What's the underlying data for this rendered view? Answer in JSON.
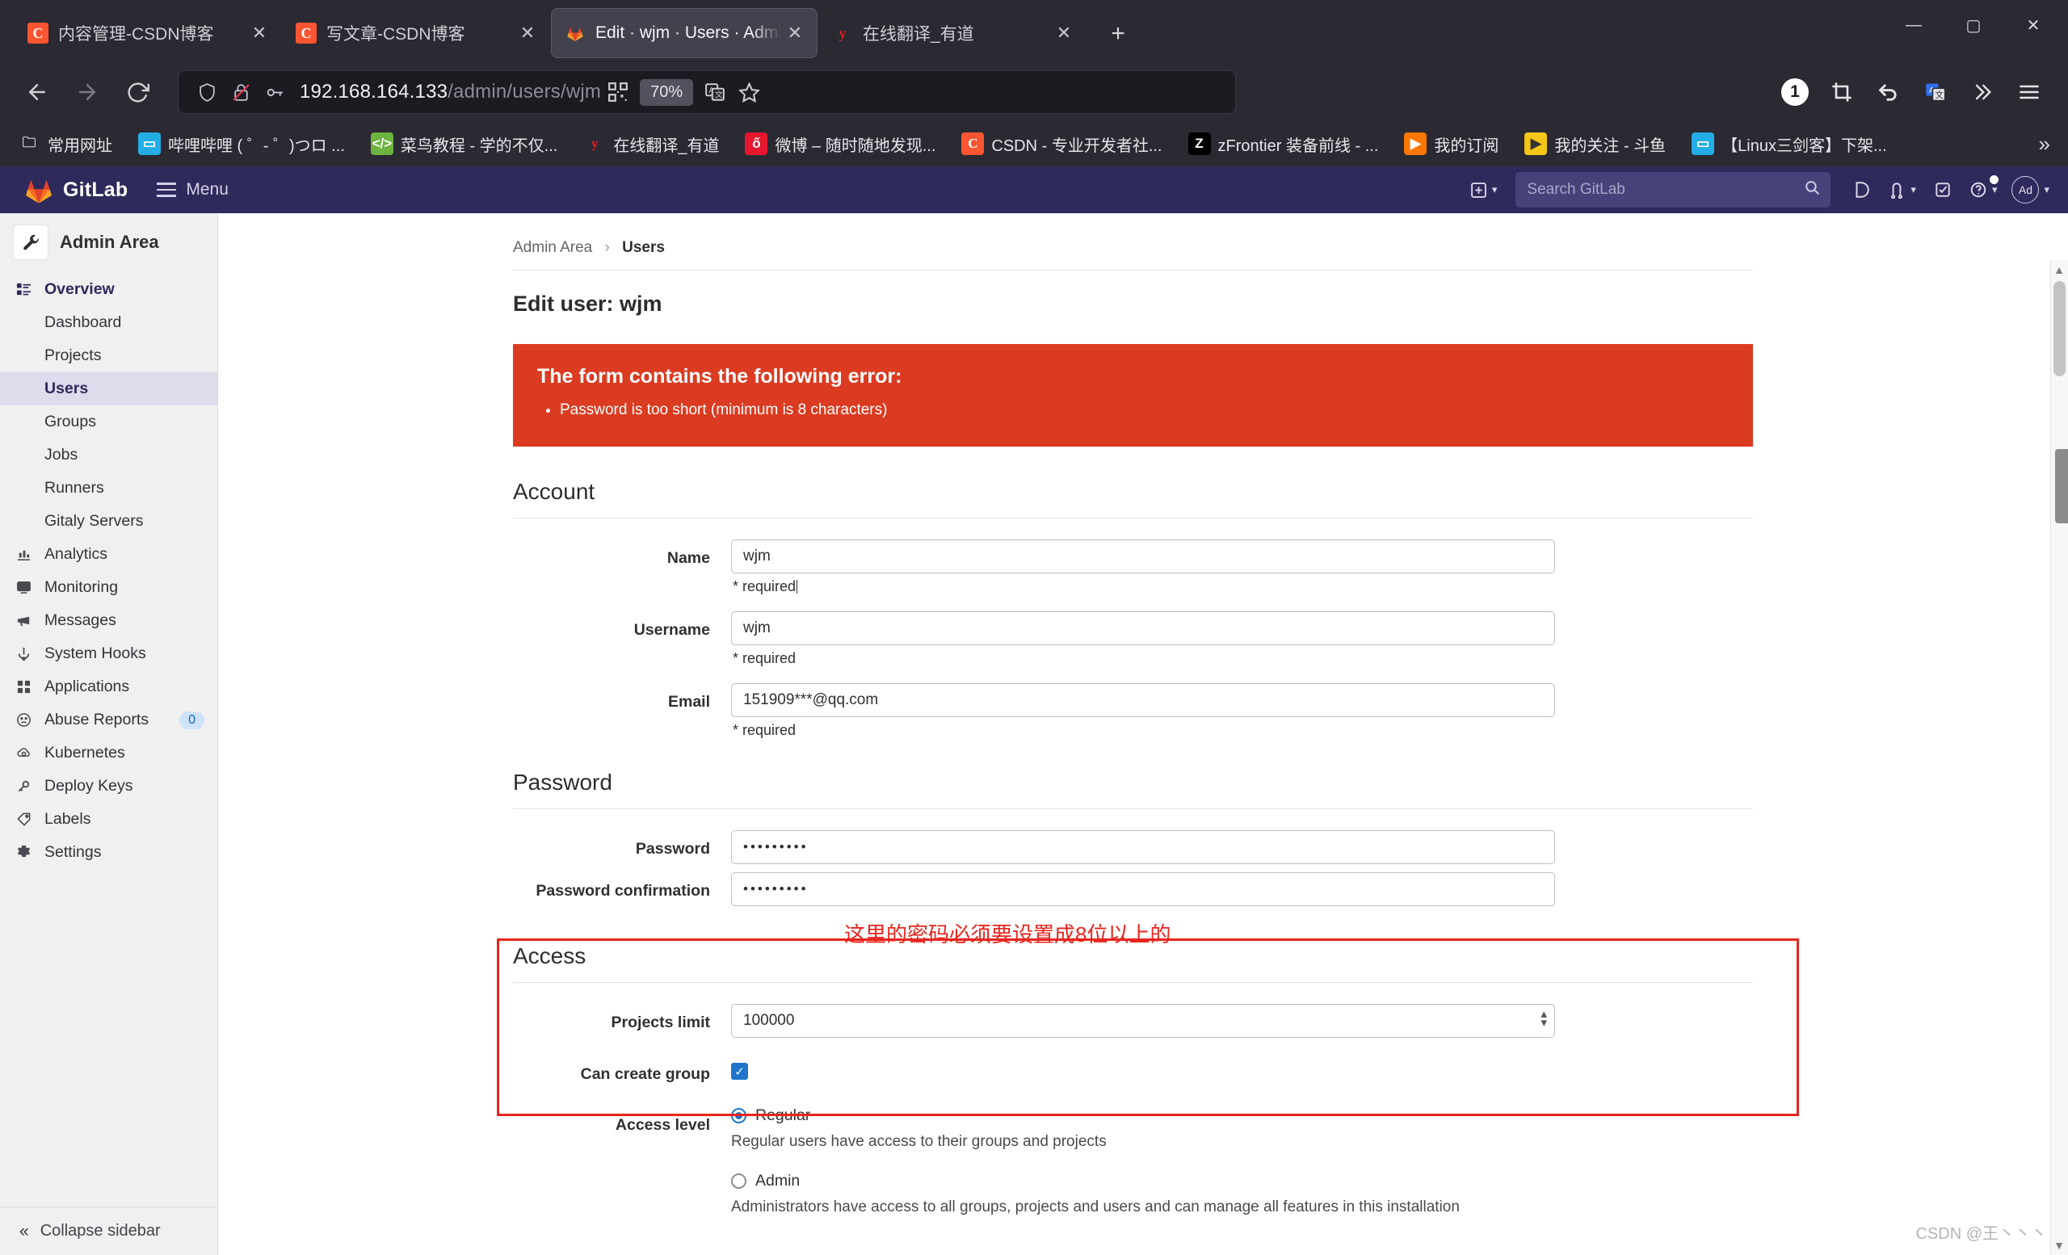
{
  "browser": {
    "tabs": [
      {
        "title": "内容管理-CSDN博客",
        "favicon": "csdn-icon",
        "favicon_letter": "C",
        "active": false
      },
      {
        "title": "写文章-CSDN博客",
        "favicon": "csdn-icon",
        "favicon_letter": "C",
        "active": false
      },
      {
        "title": "Edit · wjm · Users · Admin Area",
        "favicon": "gitlab-icon",
        "favicon_letter": "",
        "active": true
      },
      {
        "title": "在线翻译_有道",
        "favicon": "youdao-icon",
        "favicon_letter": "y",
        "active": false
      }
    ],
    "new_tab_label": "+",
    "close_label": "✕",
    "window_controls": {
      "minimize": "—",
      "maximize": "▢",
      "close": "✕"
    },
    "nav": {
      "back": "back-icon",
      "forward": "forward-icon",
      "reload": "reload-icon"
    },
    "url": {
      "host": "192.168.164.133",
      "path": "/admin/users/wjm"
    },
    "zoom_level": "70%",
    "toolbar_badge": "1",
    "bookmarks": [
      {
        "label": "常用网址",
        "icon": "folder-icon",
        "letter": "🗀"
      },
      {
        "label": "哔哩哔哩 ( ゜- ゜)つロ ...",
        "icon": "bilibili-icon",
        "letter": "▢"
      },
      {
        "label": "菜鸟教程 - 学的不仅...",
        "icon": "runoob-icon",
        "letter": "</>"
      },
      {
        "label": "在线翻译_有道",
        "icon": "youdao-icon",
        "letter": "y"
      },
      {
        "label": "微博 – 随时随地发现...",
        "icon": "weibo-icon",
        "letter": "ố"
      },
      {
        "label": "CSDN - 专业开发者社...",
        "icon": "csdn-icon",
        "letter": "C"
      },
      {
        "label": "zFrontier 装备前线 - ...",
        "icon": "zfrontier-icon",
        "letter": "Z"
      },
      {
        "label": "我的订阅",
        "icon": "douyu-icon",
        "letter": "▶"
      },
      {
        "label": "我的关注 - 斗鱼",
        "icon": "douyu-follow-icon",
        "letter": "▶"
      },
      {
        "label": "【Linux三剑客】下架...",
        "icon": "bilibili-icon",
        "letter": "▢"
      }
    ],
    "bookmarks_overflow": "»"
  },
  "gitlab": {
    "brand": "GitLab",
    "menu_label": "Menu",
    "search": {
      "placeholder": "Search GitLab",
      "value": ""
    },
    "avatar_initials": "Ad",
    "header_icons": [
      "plus-icon",
      "issues-icon",
      "merge-requests-icon",
      "todos-icon",
      "help-icon",
      "user-avatar"
    ]
  },
  "sidebar": {
    "title": "Admin Area",
    "collapse_label": "Collapse sidebar",
    "items": [
      {
        "label": "Overview",
        "icon": "overview-icon",
        "level": "top",
        "active": false
      },
      {
        "label": "Dashboard",
        "icon": "",
        "level": "sub",
        "active": false
      },
      {
        "label": "Projects",
        "icon": "",
        "level": "sub",
        "active": false
      },
      {
        "label": "Users",
        "icon": "",
        "level": "sub",
        "active": true
      },
      {
        "label": "Groups",
        "icon": "",
        "level": "sub",
        "active": false
      },
      {
        "label": "Jobs",
        "icon": "",
        "level": "sub",
        "active": false
      },
      {
        "label": "Runners",
        "icon": "",
        "level": "sub",
        "active": false
      },
      {
        "label": "Gitaly Servers",
        "icon": "",
        "level": "sub",
        "active": false
      },
      {
        "label": "Analytics",
        "icon": "analytics-icon",
        "level": "top2",
        "active": false
      },
      {
        "label": "Monitoring",
        "icon": "monitoring-icon",
        "level": "top2",
        "active": false
      },
      {
        "label": "Messages",
        "icon": "messages-icon",
        "level": "top2",
        "active": false
      },
      {
        "label": "System Hooks",
        "icon": "hooks-icon",
        "level": "top2",
        "active": false
      },
      {
        "label": "Applications",
        "icon": "applications-icon",
        "level": "top2",
        "active": false
      },
      {
        "label": "Abuse Reports",
        "icon": "abuse-icon",
        "level": "top2",
        "active": false,
        "count": "0"
      },
      {
        "label": "Kubernetes",
        "icon": "kubernetes-icon",
        "level": "top2",
        "active": false
      },
      {
        "label": "Deploy Keys",
        "icon": "key-icon",
        "level": "top2",
        "active": false
      },
      {
        "label": "Labels",
        "icon": "label-icon",
        "level": "top2",
        "active": false
      },
      {
        "label": "Settings",
        "icon": "gear-icon",
        "level": "top2",
        "active": false
      }
    ]
  },
  "page": {
    "breadcrumb": {
      "root": "Admin Area",
      "sep": "›",
      "current": "Users"
    },
    "title": "Edit user: wjm",
    "error": {
      "heading": "The form contains the following error:",
      "items": [
        "Password is too short (minimum is 8 characters)"
      ]
    },
    "annotation": "这里的密码必须要设置成8位以上的",
    "sections": {
      "account": {
        "heading": "Account",
        "fields": [
          {
            "label": "Name",
            "value": "wjm",
            "hint": "* required",
            "type": "text"
          },
          {
            "label": "Username",
            "value": "wjm",
            "hint": "* required",
            "type": "text"
          },
          {
            "label": "Email",
            "value": "151909***@qq.com",
            "hint": "* required",
            "type": "text"
          }
        ]
      },
      "password": {
        "heading": "Password",
        "fields": [
          {
            "label": "Password",
            "value": "•••••••••",
            "type": "password"
          },
          {
            "label": "Password confirmation",
            "value": "•••••••••",
            "type": "password"
          }
        ]
      },
      "access": {
        "heading": "Access",
        "projects_limit_label": "Projects limit",
        "projects_limit_value": "100000",
        "can_create_group_label": "Can create group",
        "can_create_group_checked": true,
        "access_level_label": "Access level",
        "options": [
          {
            "label": "Regular",
            "selected": true,
            "description": "Regular users have access to their groups and projects"
          },
          {
            "label": "Admin",
            "selected": false,
            "description": "Administrators have access to all groups, projects and users and can manage all features in this installation"
          }
        ]
      }
    },
    "watermark": "CSDN @王丶丶丶"
  }
}
